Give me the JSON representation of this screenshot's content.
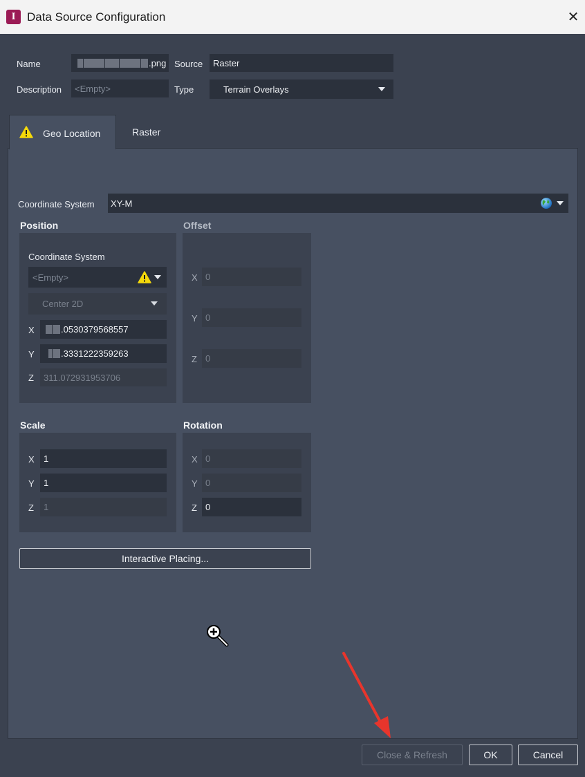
{
  "window": {
    "title": "Data Source Configuration",
    "app_icon_letter": "I",
    "close_glyph": "✕"
  },
  "form": {
    "name_label": "Name",
    "name_value_suffix": ".png",
    "source_label": "Source",
    "source_value": "Raster",
    "description_label": "Description",
    "description_placeholder": "<Empty>",
    "type_label": "Type",
    "type_value": "Terrain Overlays"
  },
  "tabs": [
    {
      "label": "Geo Location",
      "active": true,
      "warning": true
    },
    {
      "label": "Raster",
      "active": false
    }
  ],
  "geo": {
    "coord_system_label": "Coordinate System",
    "coord_system_value": "XY-M",
    "position": {
      "title": "Position",
      "coord_system_label": "Coordinate System",
      "coord_system_value": "<Empty>",
      "mode_value": "Center 2D",
      "x_label": "X",
      "x_value": ".0530379568557",
      "y_label": "Y",
      "y_value": ".3331222359263",
      "z_label": "Z",
      "z_value": "311.072931953706"
    },
    "offset": {
      "title": "Offset",
      "x_label": "X",
      "x_value": "0",
      "y_label": "Y",
      "y_value": "0",
      "z_label": "Z",
      "z_value": "0"
    },
    "scale": {
      "title": "Scale",
      "x_label": "X",
      "x_value": "1",
      "y_label": "Y",
      "y_value": "1",
      "z_label": "Z",
      "z_value": "1"
    },
    "rotation": {
      "title": "Rotation",
      "x_label": "X",
      "x_value": "0",
      "y_label": "Y",
      "y_value": "0",
      "z_label": "Z",
      "z_value": "0"
    },
    "interactive_placing_label": "Interactive Placing..."
  },
  "footer": {
    "close_refresh_label": "Close & Refresh",
    "ok_label": "OK",
    "cancel_label": "Cancel"
  },
  "colors": {
    "accent": "#9b1b55",
    "warning": "#f5d90a",
    "annotation_arrow": "#e8352c"
  }
}
